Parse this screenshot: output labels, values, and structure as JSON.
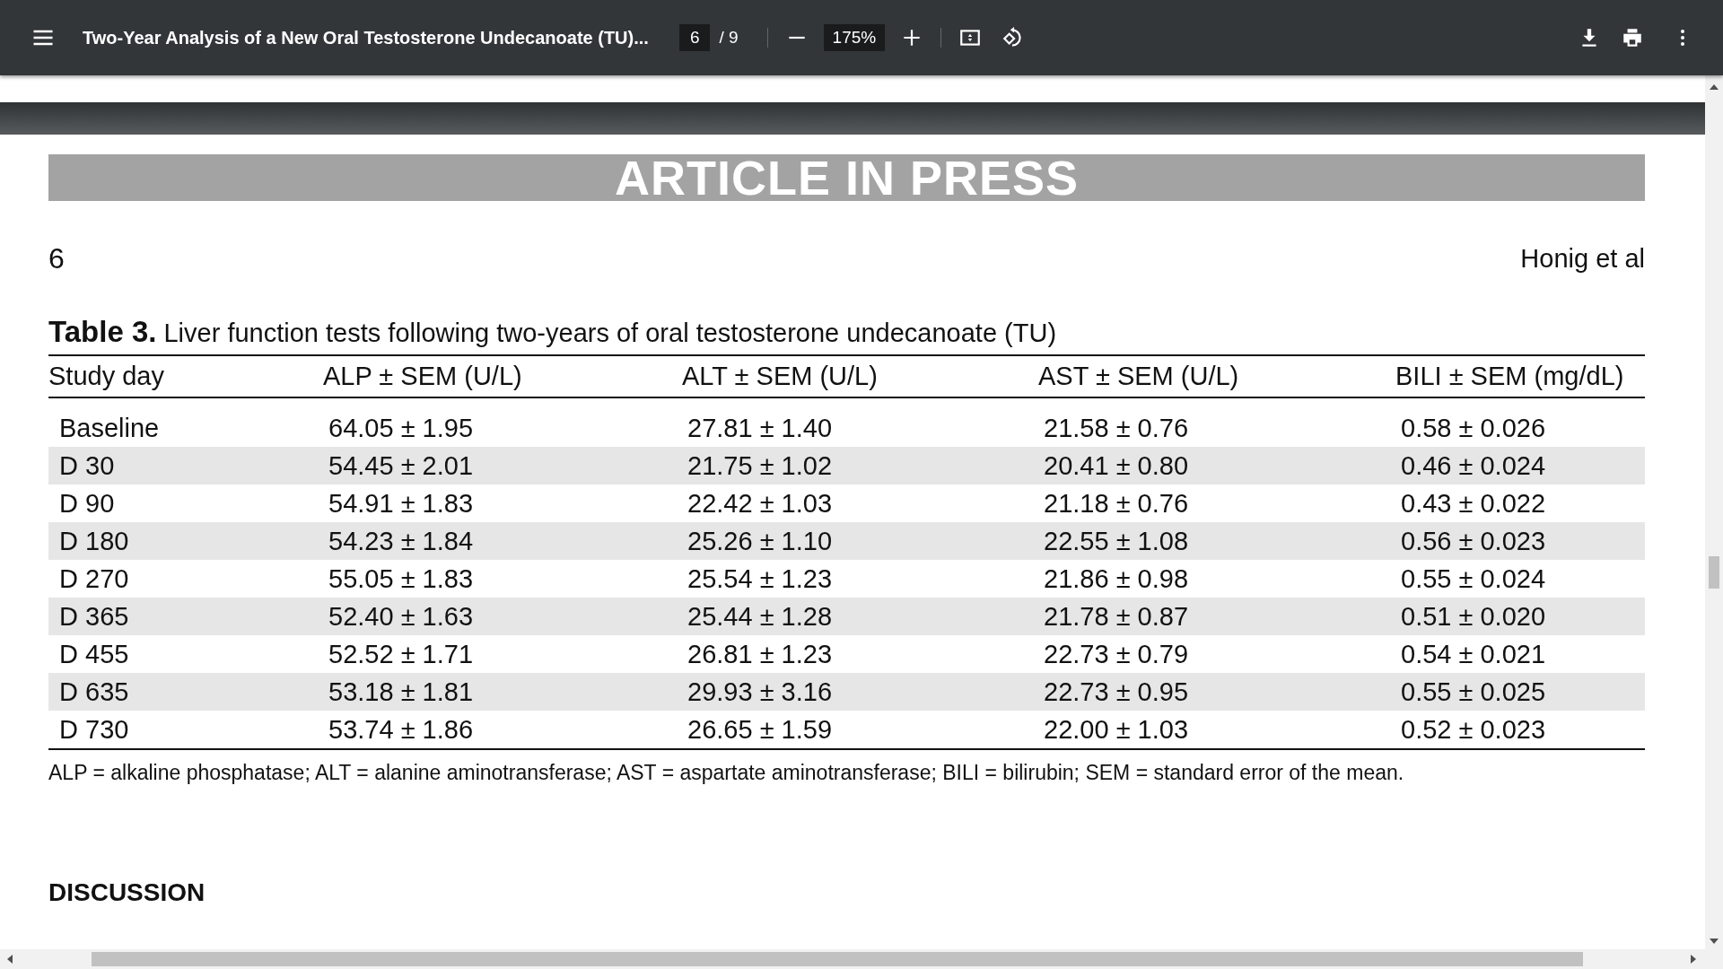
{
  "toolbar": {
    "title": "Two-Year Analysis of a New Oral Testosterone Undecanoate (TU)...",
    "page_number": "6",
    "page_total": "/ 9",
    "zoom": "175%"
  },
  "page": {
    "banner": "ARTICLE IN PRESS",
    "page_label": "6",
    "running_head": "Honig et al",
    "table": {
      "label": "Table 3.",
      "caption": "Liver function tests following two-years of oral testosterone undecanoate (TU)",
      "columns": [
        "Study day",
        "ALP ± SEM (U/L)",
        "ALT ± SEM (U/L)",
        "AST ± SEM (U/L)",
        "BILI ± SEM (mg/dL)"
      ],
      "rows": [
        [
          "Baseline",
          "64.05 ± 1.95",
          "27.81 ± 1.40",
          "21.58 ± 0.76",
          "0.58 ± 0.026"
        ],
        [
          "D 30",
          "54.45 ± 2.01",
          "21.75 ± 1.02",
          "20.41 ± 0.80",
          "0.46 ± 0.024"
        ],
        [
          "D 90",
          "54.91 ± 1.83",
          "22.42 ± 1.03",
          "21.18 ± 0.76",
          "0.43 ± 0.022"
        ],
        [
          "D 180",
          "54.23 ± 1.84",
          "25.26 ± 1.10",
          "22.55 ± 1.08",
          "0.56 ± 0.023"
        ],
        [
          "D 270",
          "55.05 ± 1.83",
          "25.54 ± 1.23",
          "21.86 ± 0.98",
          "0.55 ± 0.024"
        ],
        [
          "D 365",
          "52.40 ± 1.63",
          "25.44 ± 1.28",
          "21.78 ± 0.87",
          "0.51 ± 0.020"
        ],
        [
          "D 455",
          "52.52 ± 1.71",
          "26.81 ± 1.23",
          "22.73 ± 0.79",
          "0.54 ± 0.021"
        ],
        [
          "D 635",
          "53.18 ± 1.81",
          "29.93 ± 3.16",
          "22.73 ± 0.95",
          "0.55 ± 0.025"
        ],
        [
          "D 730",
          "53.74 ± 1.86",
          "26.65 ± 1.59",
          "22.00 ± 1.03",
          "0.52 ± 0.023"
        ]
      ],
      "footnote": "ALP = alkaline phosphatase; ALT = alanine aminotransferase; AST = aspartate aminotransferase; BILI = bilirubin; SEM = standard error of the mean."
    },
    "section_heading": "DISCUSSION"
  }
}
